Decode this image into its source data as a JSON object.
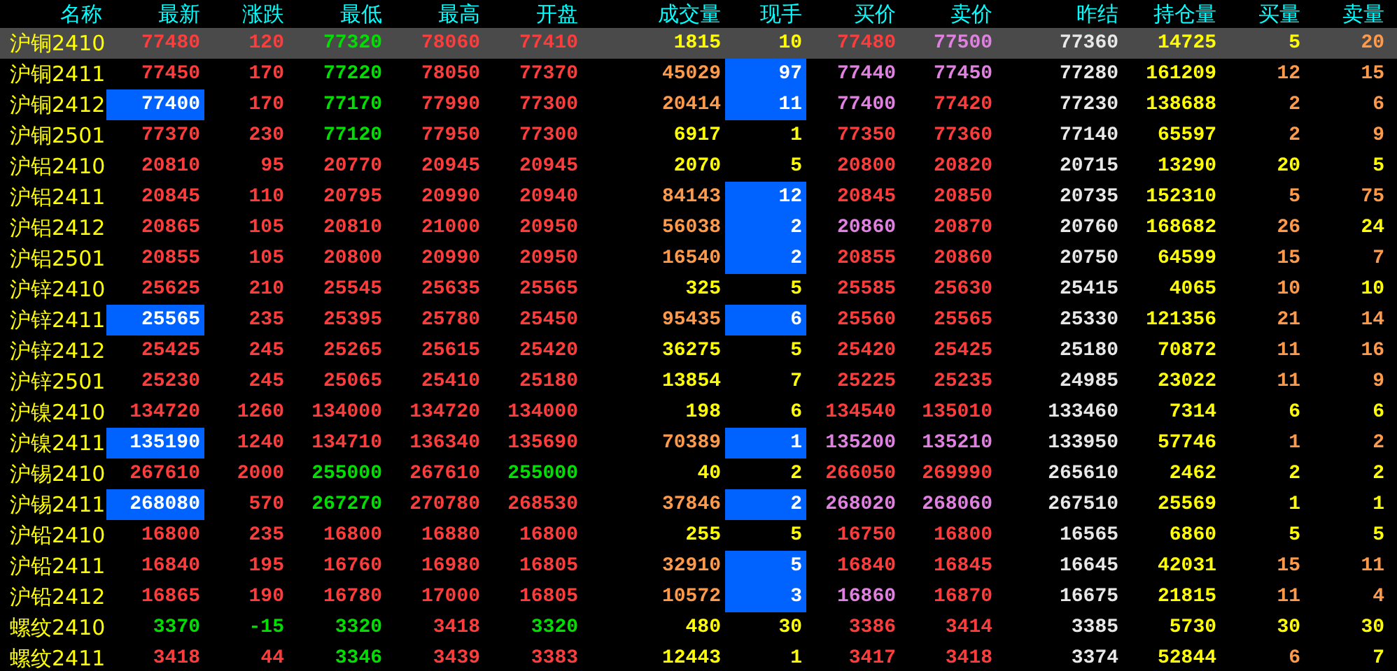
{
  "columns": [
    "名称",
    "最新",
    "涨跌",
    "最低",
    "最高",
    "开盘",
    "成交量",
    "现手",
    "买价",
    "卖价",
    "昨结",
    "持仓量",
    "买量",
    "卖量"
  ],
  "rows": [
    {
      "name": "沪铜2410",
      "selected": true,
      "cells": [
        {
          "text": "77480",
          "color": "#ff3c3c",
          "highlighted": false
        },
        {
          "text": "120",
          "color": "#ff3c3c",
          "highlighted": false
        },
        {
          "text": "77320",
          "color": "#00e000",
          "highlighted": false
        },
        {
          "text": "78060",
          "color": "#ff3c3c",
          "highlighted": false
        },
        {
          "text": "77410",
          "color": "#ff3c3c",
          "highlighted": false
        },
        {
          "text": "1815",
          "color": "#ffff00",
          "highlighted": false
        },
        {
          "text": "10",
          "color": "#ffff00",
          "highlighted": false
        },
        {
          "text": "77480",
          "color": "#ff3c3c",
          "highlighted": false
        },
        {
          "text": "77500",
          "color": "#e080e0",
          "highlighted": false
        },
        {
          "text": "77360",
          "color": "#e8e8e8",
          "highlighted": false
        },
        {
          "text": "14725",
          "color": "#ffff00",
          "highlighted": false
        },
        {
          "text": "5",
          "color": "#ffff00",
          "highlighted": false
        },
        {
          "text": "20",
          "color": "#ff9a4a",
          "highlighted": false
        }
      ]
    },
    {
      "name": "沪铜2411",
      "selected": false,
      "cells": [
        {
          "text": "77450",
          "color": "#ff3c3c",
          "highlighted": false
        },
        {
          "text": "170",
          "color": "#ff3c3c",
          "highlighted": false
        },
        {
          "text": "77220",
          "color": "#00e000",
          "highlighted": false
        },
        {
          "text": "78050",
          "color": "#ff3c3c",
          "highlighted": false
        },
        {
          "text": "77370",
          "color": "#ff3c3c",
          "highlighted": false
        },
        {
          "text": "45029",
          "color": "#ff9a4a",
          "highlighted": false
        },
        {
          "text": "97",
          "color": "#ffffff",
          "highlighted": true
        },
        {
          "text": "77440",
          "color": "#e080e0",
          "highlighted": false
        },
        {
          "text": "77450",
          "color": "#e080e0",
          "highlighted": false
        },
        {
          "text": "77280",
          "color": "#e8e8e8",
          "highlighted": false
        },
        {
          "text": "161209",
          "color": "#ffff00",
          "highlighted": false
        },
        {
          "text": "12",
          "color": "#ff9a4a",
          "highlighted": false
        },
        {
          "text": "15",
          "color": "#ff9a4a",
          "highlighted": false
        }
      ]
    },
    {
      "name": "沪铜2412",
      "selected": false,
      "cells": [
        {
          "text": "77400",
          "color": "#ffffff",
          "highlighted": true
        },
        {
          "text": "170",
          "color": "#ff3c3c",
          "highlighted": false
        },
        {
          "text": "77170",
          "color": "#00e000",
          "highlighted": false
        },
        {
          "text": "77990",
          "color": "#ff3c3c",
          "highlighted": false
        },
        {
          "text": "77300",
          "color": "#ff3c3c",
          "highlighted": false
        },
        {
          "text": "20414",
          "color": "#ff9a4a",
          "highlighted": false
        },
        {
          "text": "11",
          "color": "#ffffff",
          "highlighted": true
        },
        {
          "text": "77400",
          "color": "#e080e0",
          "highlighted": false
        },
        {
          "text": "77420",
          "color": "#ff3c3c",
          "highlighted": false
        },
        {
          "text": "77230",
          "color": "#e8e8e8",
          "highlighted": false
        },
        {
          "text": "138688",
          "color": "#ffff00",
          "highlighted": false
        },
        {
          "text": "2",
          "color": "#ff9a4a",
          "highlighted": false
        },
        {
          "text": "6",
          "color": "#ff9a4a",
          "highlighted": false
        }
      ]
    },
    {
      "name": "沪铜2501",
      "selected": false,
      "cells": [
        {
          "text": "77370",
          "color": "#ff3c3c",
          "highlighted": false
        },
        {
          "text": "230",
          "color": "#ff3c3c",
          "highlighted": false
        },
        {
          "text": "77120",
          "color": "#00e000",
          "highlighted": false
        },
        {
          "text": "77950",
          "color": "#ff3c3c",
          "highlighted": false
        },
        {
          "text": "77300",
          "color": "#ff3c3c",
          "highlighted": false
        },
        {
          "text": "6917",
          "color": "#ffff00",
          "highlighted": false
        },
        {
          "text": "1",
          "color": "#ffff00",
          "highlighted": false
        },
        {
          "text": "77350",
          "color": "#ff3c3c",
          "highlighted": false
        },
        {
          "text": "77360",
          "color": "#ff3c3c",
          "highlighted": false
        },
        {
          "text": "77140",
          "color": "#e8e8e8",
          "highlighted": false
        },
        {
          "text": "65597",
          "color": "#ffff00",
          "highlighted": false
        },
        {
          "text": "2",
          "color": "#ff9a4a",
          "highlighted": false
        },
        {
          "text": "9",
          "color": "#ff9a4a",
          "highlighted": false
        }
      ]
    },
    {
      "name": "沪铝2410",
      "selected": false,
      "cells": [
        {
          "text": "20810",
          "color": "#ff3c3c",
          "highlighted": false
        },
        {
          "text": "95",
          "color": "#ff3c3c",
          "highlighted": false
        },
        {
          "text": "20770",
          "color": "#ff3c3c",
          "highlighted": false
        },
        {
          "text": "20945",
          "color": "#ff3c3c",
          "highlighted": false
        },
        {
          "text": "20945",
          "color": "#ff3c3c",
          "highlighted": false
        },
        {
          "text": "2070",
          "color": "#ffff00",
          "highlighted": false
        },
        {
          "text": "5",
          "color": "#ffff00",
          "highlighted": false
        },
        {
          "text": "20800",
          "color": "#ff3c3c",
          "highlighted": false
        },
        {
          "text": "20820",
          "color": "#ff3c3c",
          "highlighted": false
        },
        {
          "text": "20715",
          "color": "#e8e8e8",
          "highlighted": false
        },
        {
          "text": "13290",
          "color": "#ffff00",
          "highlighted": false
        },
        {
          "text": "20",
          "color": "#ffff00",
          "highlighted": false
        },
        {
          "text": "5",
          "color": "#ffff00",
          "highlighted": false
        }
      ]
    },
    {
      "name": "沪铝2411",
      "selected": false,
      "cells": [
        {
          "text": "20845",
          "color": "#ff3c3c",
          "highlighted": false
        },
        {
          "text": "110",
          "color": "#ff3c3c",
          "highlighted": false
        },
        {
          "text": "20795",
          "color": "#ff3c3c",
          "highlighted": false
        },
        {
          "text": "20990",
          "color": "#ff3c3c",
          "highlighted": false
        },
        {
          "text": "20940",
          "color": "#ff3c3c",
          "highlighted": false
        },
        {
          "text": "84143",
          "color": "#ff9a4a",
          "highlighted": false
        },
        {
          "text": "12",
          "color": "#ffffff",
          "highlighted": true
        },
        {
          "text": "20845",
          "color": "#ff3c3c",
          "highlighted": false
        },
        {
          "text": "20850",
          "color": "#ff3c3c",
          "highlighted": false
        },
        {
          "text": "20735",
          "color": "#e8e8e8",
          "highlighted": false
        },
        {
          "text": "152310",
          "color": "#ffff00",
          "highlighted": false
        },
        {
          "text": "5",
          "color": "#ff9a4a",
          "highlighted": false
        },
        {
          "text": "75",
          "color": "#ff9a4a",
          "highlighted": false
        }
      ]
    },
    {
      "name": "沪铝2412",
      "selected": false,
      "cells": [
        {
          "text": "20865",
          "color": "#ff3c3c",
          "highlighted": false
        },
        {
          "text": "105",
          "color": "#ff3c3c",
          "highlighted": false
        },
        {
          "text": "20810",
          "color": "#ff3c3c",
          "highlighted": false
        },
        {
          "text": "21000",
          "color": "#ff3c3c",
          "highlighted": false
        },
        {
          "text": "20950",
          "color": "#ff3c3c",
          "highlighted": false
        },
        {
          "text": "56038",
          "color": "#ff9a4a",
          "highlighted": false
        },
        {
          "text": "2",
          "color": "#ffffff",
          "highlighted": true
        },
        {
          "text": "20860",
          "color": "#e080e0",
          "highlighted": false
        },
        {
          "text": "20870",
          "color": "#ff3c3c",
          "highlighted": false
        },
        {
          "text": "20760",
          "color": "#e8e8e8",
          "highlighted": false
        },
        {
          "text": "168682",
          "color": "#ffff00",
          "highlighted": false
        },
        {
          "text": "26",
          "color": "#ff9a4a",
          "highlighted": false
        },
        {
          "text": "24",
          "color": "#ffff00",
          "highlighted": false
        }
      ]
    },
    {
      "name": "沪铝2501",
      "selected": false,
      "cells": [
        {
          "text": "20855",
          "color": "#ff3c3c",
          "highlighted": false
        },
        {
          "text": "105",
          "color": "#ff3c3c",
          "highlighted": false
        },
        {
          "text": "20800",
          "color": "#ff3c3c",
          "highlighted": false
        },
        {
          "text": "20990",
          "color": "#ff3c3c",
          "highlighted": false
        },
        {
          "text": "20950",
          "color": "#ff3c3c",
          "highlighted": false
        },
        {
          "text": "16540",
          "color": "#ff9a4a",
          "highlighted": false
        },
        {
          "text": "2",
          "color": "#ffffff",
          "highlighted": true
        },
        {
          "text": "20855",
          "color": "#ff3c3c",
          "highlighted": false
        },
        {
          "text": "20860",
          "color": "#ff3c3c",
          "highlighted": false
        },
        {
          "text": "20750",
          "color": "#e8e8e8",
          "highlighted": false
        },
        {
          "text": "64599",
          "color": "#ffff00",
          "highlighted": false
        },
        {
          "text": "15",
          "color": "#ff9a4a",
          "highlighted": false
        },
        {
          "text": "7",
          "color": "#ff9a4a",
          "highlighted": false
        }
      ]
    },
    {
      "name": "沪锌2410",
      "selected": false,
      "cells": [
        {
          "text": "25625",
          "color": "#ff3c3c",
          "highlighted": false
        },
        {
          "text": "210",
          "color": "#ff3c3c",
          "highlighted": false
        },
        {
          "text": "25545",
          "color": "#ff3c3c",
          "highlighted": false
        },
        {
          "text": "25635",
          "color": "#ff3c3c",
          "highlighted": false
        },
        {
          "text": "25565",
          "color": "#ff3c3c",
          "highlighted": false
        },
        {
          "text": "325",
          "color": "#ffff00",
          "highlighted": false
        },
        {
          "text": "5",
          "color": "#ffff00",
          "highlighted": false
        },
        {
          "text": "25585",
          "color": "#ff3c3c",
          "highlighted": false
        },
        {
          "text": "25630",
          "color": "#ff3c3c",
          "highlighted": false
        },
        {
          "text": "25415",
          "color": "#e8e8e8",
          "highlighted": false
        },
        {
          "text": "4065",
          "color": "#ffff00",
          "highlighted": false
        },
        {
          "text": "10",
          "color": "#ff9a4a",
          "highlighted": false
        },
        {
          "text": "10",
          "color": "#ffff00",
          "highlighted": false
        }
      ]
    },
    {
      "name": "沪锌2411",
      "selected": false,
      "cells": [
        {
          "text": "25565",
          "color": "#ffffff",
          "highlighted": true
        },
        {
          "text": "235",
          "color": "#ff3c3c",
          "highlighted": false
        },
        {
          "text": "25395",
          "color": "#ff3c3c",
          "highlighted": false
        },
        {
          "text": "25780",
          "color": "#ff3c3c",
          "highlighted": false
        },
        {
          "text": "25450",
          "color": "#ff3c3c",
          "highlighted": false
        },
        {
          "text": "95435",
          "color": "#ff9a4a",
          "highlighted": false
        },
        {
          "text": "6",
          "color": "#ffffff",
          "highlighted": true
        },
        {
          "text": "25560",
          "color": "#ff3c3c",
          "highlighted": false
        },
        {
          "text": "25565",
          "color": "#ff3c3c",
          "highlighted": false
        },
        {
          "text": "25330",
          "color": "#e8e8e8",
          "highlighted": false
        },
        {
          "text": "121356",
          "color": "#ffff00",
          "highlighted": false
        },
        {
          "text": "21",
          "color": "#ff9a4a",
          "highlighted": false
        },
        {
          "text": "14",
          "color": "#ff9a4a",
          "highlighted": false
        }
      ]
    },
    {
      "name": "沪锌2412",
      "selected": false,
      "cells": [
        {
          "text": "25425",
          "color": "#ff3c3c",
          "highlighted": false
        },
        {
          "text": "245",
          "color": "#ff3c3c",
          "highlighted": false
        },
        {
          "text": "25265",
          "color": "#ff3c3c",
          "highlighted": false
        },
        {
          "text": "25615",
          "color": "#ff3c3c",
          "highlighted": false
        },
        {
          "text": "25420",
          "color": "#ff3c3c",
          "highlighted": false
        },
        {
          "text": "36275",
          "color": "#ffff00",
          "highlighted": false
        },
        {
          "text": "5",
          "color": "#ffff00",
          "highlighted": false
        },
        {
          "text": "25420",
          "color": "#ff3c3c",
          "highlighted": false
        },
        {
          "text": "25425",
          "color": "#ff3c3c",
          "highlighted": false
        },
        {
          "text": "25180",
          "color": "#e8e8e8",
          "highlighted": false
        },
        {
          "text": "70872",
          "color": "#ffff00",
          "highlighted": false
        },
        {
          "text": "11",
          "color": "#ff9a4a",
          "highlighted": false
        },
        {
          "text": "16",
          "color": "#ff9a4a",
          "highlighted": false
        }
      ]
    },
    {
      "name": "沪锌2501",
      "selected": false,
      "cells": [
        {
          "text": "25230",
          "color": "#ff3c3c",
          "highlighted": false
        },
        {
          "text": "245",
          "color": "#ff3c3c",
          "highlighted": false
        },
        {
          "text": "25065",
          "color": "#ff3c3c",
          "highlighted": false
        },
        {
          "text": "25410",
          "color": "#ff3c3c",
          "highlighted": false
        },
        {
          "text": "25180",
          "color": "#ff3c3c",
          "highlighted": false
        },
        {
          "text": "13854",
          "color": "#ffff00",
          "highlighted": false
        },
        {
          "text": "7",
          "color": "#ffff00",
          "highlighted": false
        },
        {
          "text": "25225",
          "color": "#ff3c3c",
          "highlighted": false
        },
        {
          "text": "25235",
          "color": "#ff3c3c",
          "highlighted": false
        },
        {
          "text": "24985",
          "color": "#e8e8e8",
          "highlighted": false
        },
        {
          "text": "23022",
          "color": "#ffff00",
          "highlighted": false
        },
        {
          "text": "11",
          "color": "#ff9a4a",
          "highlighted": false
        },
        {
          "text": "9",
          "color": "#ff9a4a",
          "highlighted": false
        }
      ]
    },
    {
      "name": "沪镍2410",
      "selected": false,
      "cells": [
        {
          "text": "134720",
          "color": "#ff3c3c",
          "highlighted": false
        },
        {
          "text": "1260",
          "color": "#ff3c3c",
          "highlighted": false
        },
        {
          "text": "134000",
          "color": "#ff3c3c",
          "highlighted": false
        },
        {
          "text": "134720",
          "color": "#ff3c3c",
          "highlighted": false
        },
        {
          "text": "134000",
          "color": "#ff3c3c",
          "highlighted": false
        },
        {
          "text": "198",
          "color": "#ffff00",
          "highlighted": false
        },
        {
          "text": "6",
          "color": "#ffff00",
          "highlighted": false
        },
        {
          "text": "134540",
          "color": "#ff3c3c",
          "highlighted": false
        },
        {
          "text": "135010",
          "color": "#ff3c3c",
          "highlighted": false
        },
        {
          "text": "133460",
          "color": "#e8e8e8",
          "highlighted": false
        },
        {
          "text": "7314",
          "color": "#ffff00",
          "highlighted": false
        },
        {
          "text": "6",
          "color": "#ffff00",
          "highlighted": false
        },
        {
          "text": "6",
          "color": "#ffff00",
          "highlighted": false
        }
      ]
    },
    {
      "name": "沪镍2411",
      "selected": false,
      "cells": [
        {
          "text": "135190",
          "color": "#ffffff",
          "highlighted": true
        },
        {
          "text": "1240",
          "color": "#ff3c3c",
          "highlighted": false
        },
        {
          "text": "134710",
          "color": "#ff3c3c",
          "highlighted": false
        },
        {
          "text": "136340",
          "color": "#ff3c3c",
          "highlighted": false
        },
        {
          "text": "135690",
          "color": "#ff3c3c",
          "highlighted": false
        },
        {
          "text": "70389",
          "color": "#ff9a4a",
          "highlighted": false
        },
        {
          "text": "1",
          "color": "#ffffff",
          "highlighted": true
        },
        {
          "text": "135200",
          "color": "#e080e0",
          "highlighted": false
        },
        {
          "text": "135210",
          "color": "#e080e0",
          "highlighted": false
        },
        {
          "text": "133950",
          "color": "#e8e8e8",
          "highlighted": false
        },
        {
          "text": "57746",
          "color": "#ffff00",
          "highlighted": false
        },
        {
          "text": "1",
          "color": "#ff9a4a",
          "highlighted": false
        },
        {
          "text": "2",
          "color": "#ff9a4a",
          "highlighted": false
        }
      ]
    },
    {
      "name": "沪锡2410",
      "selected": false,
      "cells": [
        {
          "text": "267610",
          "color": "#ff3c3c",
          "highlighted": false
        },
        {
          "text": "2000",
          "color": "#ff3c3c",
          "highlighted": false
        },
        {
          "text": "255000",
          "color": "#00e000",
          "highlighted": false
        },
        {
          "text": "267610",
          "color": "#ff3c3c",
          "highlighted": false
        },
        {
          "text": "255000",
          "color": "#00e000",
          "highlighted": false
        },
        {
          "text": "40",
          "color": "#ffff00",
          "highlighted": false
        },
        {
          "text": "2",
          "color": "#ffff00",
          "highlighted": false
        },
        {
          "text": "266050",
          "color": "#ff3c3c",
          "highlighted": false
        },
        {
          "text": "269990",
          "color": "#ff3c3c",
          "highlighted": false
        },
        {
          "text": "265610",
          "color": "#e8e8e8",
          "highlighted": false
        },
        {
          "text": "2462",
          "color": "#ffff00",
          "highlighted": false
        },
        {
          "text": "2",
          "color": "#ffff00",
          "highlighted": false
        },
        {
          "text": "2",
          "color": "#ffff00",
          "highlighted": false
        }
      ]
    },
    {
      "name": "沪锡2411",
      "selected": false,
      "cells": [
        {
          "text": "268080",
          "color": "#ffffff",
          "highlighted": true
        },
        {
          "text": "570",
          "color": "#ff3c3c",
          "highlighted": false
        },
        {
          "text": "267270",
          "color": "#00e000",
          "highlighted": false
        },
        {
          "text": "270780",
          "color": "#ff3c3c",
          "highlighted": false
        },
        {
          "text": "268530",
          "color": "#ff3c3c",
          "highlighted": false
        },
        {
          "text": "37846",
          "color": "#ff9a4a",
          "highlighted": false
        },
        {
          "text": "2",
          "color": "#ffffff",
          "highlighted": true
        },
        {
          "text": "268020",
          "color": "#e080e0",
          "highlighted": false
        },
        {
          "text": "268060",
          "color": "#e080e0",
          "highlighted": false
        },
        {
          "text": "267510",
          "color": "#e8e8e8",
          "highlighted": false
        },
        {
          "text": "25569",
          "color": "#ffff00",
          "highlighted": false
        },
        {
          "text": "1",
          "color": "#ffff00",
          "highlighted": false
        },
        {
          "text": "1",
          "color": "#ffff00",
          "highlighted": false
        }
      ]
    },
    {
      "name": "沪铅2410",
      "selected": false,
      "cells": [
        {
          "text": "16800",
          "color": "#ff3c3c",
          "highlighted": false
        },
        {
          "text": "235",
          "color": "#ff3c3c",
          "highlighted": false
        },
        {
          "text": "16800",
          "color": "#ff3c3c",
          "highlighted": false
        },
        {
          "text": "16880",
          "color": "#ff3c3c",
          "highlighted": false
        },
        {
          "text": "16800",
          "color": "#ff3c3c",
          "highlighted": false
        },
        {
          "text": "255",
          "color": "#ffff00",
          "highlighted": false
        },
        {
          "text": "5",
          "color": "#ffff00",
          "highlighted": false
        },
        {
          "text": "16750",
          "color": "#ff3c3c",
          "highlighted": false
        },
        {
          "text": "16800",
          "color": "#ff3c3c",
          "highlighted": false
        },
        {
          "text": "16565",
          "color": "#e8e8e8",
          "highlighted": false
        },
        {
          "text": "6860",
          "color": "#ffff00",
          "highlighted": false
        },
        {
          "text": "5",
          "color": "#ffff00",
          "highlighted": false
        },
        {
          "text": "5",
          "color": "#ffff00",
          "highlighted": false
        }
      ]
    },
    {
      "name": "沪铅2411",
      "selected": false,
      "cells": [
        {
          "text": "16840",
          "color": "#ff3c3c",
          "highlighted": false
        },
        {
          "text": "195",
          "color": "#ff3c3c",
          "highlighted": false
        },
        {
          "text": "16760",
          "color": "#ff3c3c",
          "highlighted": false
        },
        {
          "text": "16980",
          "color": "#ff3c3c",
          "highlighted": false
        },
        {
          "text": "16805",
          "color": "#ff3c3c",
          "highlighted": false
        },
        {
          "text": "32910",
          "color": "#ff9a4a",
          "highlighted": false
        },
        {
          "text": "5",
          "color": "#ffffff",
          "highlighted": true
        },
        {
          "text": "16840",
          "color": "#ff3c3c",
          "highlighted": false
        },
        {
          "text": "16845",
          "color": "#ff3c3c",
          "highlighted": false
        },
        {
          "text": "16645",
          "color": "#e8e8e8",
          "highlighted": false
        },
        {
          "text": "42031",
          "color": "#ffff00",
          "highlighted": false
        },
        {
          "text": "15",
          "color": "#ff9a4a",
          "highlighted": false
        },
        {
          "text": "11",
          "color": "#ff9a4a",
          "highlighted": false
        }
      ]
    },
    {
      "name": "沪铅2412",
      "selected": false,
      "cells": [
        {
          "text": "16865",
          "color": "#ff3c3c",
          "highlighted": false
        },
        {
          "text": "190",
          "color": "#ff3c3c",
          "highlighted": false
        },
        {
          "text": "16780",
          "color": "#ff3c3c",
          "highlighted": false
        },
        {
          "text": "17000",
          "color": "#ff3c3c",
          "highlighted": false
        },
        {
          "text": "16805",
          "color": "#ff3c3c",
          "highlighted": false
        },
        {
          "text": "10572",
          "color": "#ff9a4a",
          "highlighted": false
        },
        {
          "text": "3",
          "color": "#ffffff",
          "highlighted": true
        },
        {
          "text": "16860",
          "color": "#e080e0",
          "highlighted": false
        },
        {
          "text": "16870",
          "color": "#ff3c3c",
          "highlighted": false
        },
        {
          "text": "16675",
          "color": "#e8e8e8",
          "highlighted": false
        },
        {
          "text": "21815",
          "color": "#ffff00",
          "highlighted": false
        },
        {
          "text": "11",
          "color": "#ff9a4a",
          "highlighted": false
        },
        {
          "text": "4",
          "color": "#ff9a4a",
          "highlighted": false
        }
      ]
    },
    {
      "name": "螺纹2410",
      "selected": false,
      "cells": [
        {
          "text": "3370",
          "color": "#00e000",
          "highlighted": false
        },
        {
          "text": "-15",
          "color": "#00e000",
          "highlighted": false
        },
        {
          "text": "3320",
          "color": "#00e000",
          "highlighted": false
        },
        {
          "text": "3418",
          "color": "#ff3c3c",
          "highlighted": false
        },
        {
          "text": "3320",
          "color": "#00e000",
          "highlighted": false
        },
        {
          "text": "480",
          "color": "#ffff00",
          "highlighted": false
        },
        {
          "text": "30",
          "color": "#ffff00",
          "highlighted": false
        },
        {
          "text": "3386",
          "color": "#ff3c3c",
          "highlighted": false
        },
        {
          "text": "3414",
          "color": "#ff3c3c",
          "highlighted": false
        },
        {
          "text": "3385",
          "color": "#e8e8e8",
          "highlighted": false
        },
        {
          "text": "5730",
          "color": "#ffff00",
          "highlighted": false
        },
        {
          "text": "30",
          "color": "#ffff00",
          "highlighted": false
        },
        {
          "text": "30",
          "color": "#ffff00",
          "highlighted": false
        }
      ]
    },
    {
      "name": "螺纹2411",
      "selected": false,
      "cells": [
        {
          "text": "3418",
          "color": "#ff3c3c",
          "highlighted": false
        },
        {
          "text": "44",
          "color": "#ff3c3c",
          "highlighted": false
        },
        {
          "text": "3346",
          "color": "#00e000",
          "highlighted": false
        },
        {
          "text": "3439",
          "color": "#ff3c3c",
          "highlighted": false
        },
        {
          "text": "3383",
          "color": "#ff3c3c",
          "highlighted": false
        },
        {
          "text": "12443",
          "color": "#ffff00",
          "highlighted": false
        },
        {
          "text": "1",
          "color": "#ffff00",
          "highlighted": false
        },
        {
          "text": "3417",
          "color": "#ff3c3c",
          "highlighted": false
        },
        {
          "text": "3418",
          "color": "#ff3c3c",
          "highlighted": false
        },
        {
          "text": "3374",
          "color": "#e8e8e8",
          "highlighted": false
        },
        {
          "text": "52844",
          "color": "#ffff00",
          "highlighted": false
        },
        {
          "text": "6",
          "color": "#ff9a4a",
          "highlighted": false
        },
        {
          "text": "7",
          "color": "#ffff00",
          "highlighted": false
        }
      ]
    }
  ]
}
